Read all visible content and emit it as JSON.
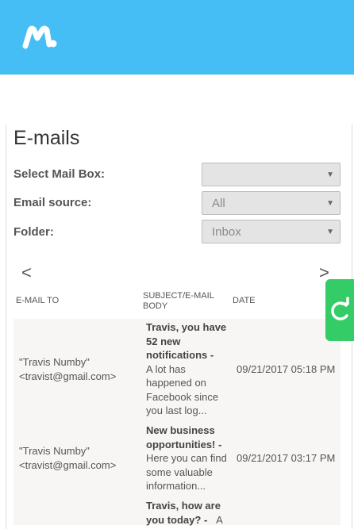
{
  "header": {
    "logo_icon": "mspy-m-logo-icon",
    "bg_color": "#45bdf5"
  },
  "page": {
    "title": "E-mails"
  },
  "filters": {
    "mailbox_label": "Select Mail Box:",
    "mailbox_value": "",
    "source_label": "Email source:",
    "source_value": "All",
    "folder_label": "Folder:",
    "folder_value": "Inbox"
  },
  "pager": {
    "prev": "<",
    "next": ">"
  },
  "table": {
    "headers": [
      "E-MAIL TO",
      "SUBJECT/E-MAIL",
      "BODY",
      "DATE"
    ],
    "rows": [
      {
        "to_name": "\"Travis Numby\"",
        "to_email": "<travist@gmail.com>",
        "subject_lines": [
          "Travis, you have",
          "52 new",
          "notifications -"
        ],
        "body_lines": [
          "A lot has",
          "happened on",
          "Facebook since",
          "you last log..."
        ],
        "date": "09/21/2017 05:18 PM"
      },
      {
        "to_name": "\"Travis Numby\"",
        "to_email": "<travist@gmail.com>",
        "subject_lines": [
          "New business",
          "opportunities! -"
        ],
        "body_lines": [
          "Here you can find",
          "some valuable",
          "information..."
        ],
        "date": "09/21/2017 03:17 PM"
      },
      {
        "subject_lines": [
          "Travis, how are",
          "you today? -"
        ],
        "body_tail": "A"
      }
    ]
  },
  "sync_button": {
    "icon": "refresh-icon",
    "color": "#33cc66"
  }
}
